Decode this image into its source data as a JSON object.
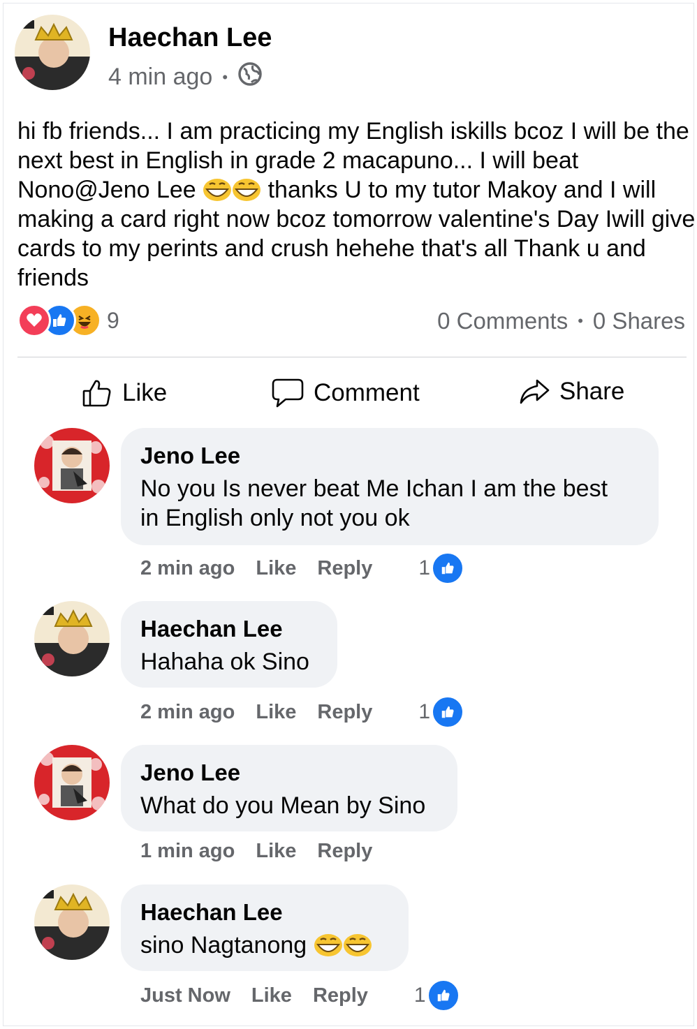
{
  "post": {
    "author": "Haechan Lee",
    "time": "4 min ago",
    "privacy_icon": "globe-icon",
    "text_parts": [
      "hi fb friends... I am practicing my English iskills bcoz I will be the next best in English in grade 2 macapuno... I will beat Nono@Jeno Lee ",
      " thanks U to my tutor Makoy and I will making a card right now bcoz tomorrow valentine's Day Iwill give cards to my perints and crush hehehe that's all Thank u and friends"
    ],
    "reaction_icons": [
      "heart-icon",
      "thumbs-up-icon",
      "laugh-icon"
    ],
    "reaction_count": "9",
    "comments_count": "0 Comments",
    "shares_count": "0 Shares"
  },
  "actions": {
    "like": "Like",
    "comment": "Comment",
    "share": "Share"
  },
  "comments": [
    {
      "name": "Jeno Lee",
      "text_line1": "No you Is never beat Me Ichan I am the best",
      "text_line2": "in English only not you ok",
      "time": "2 min ago",
      "like": "Like",
      "reply": "Reply",
      "likes": "1"
    },
    {
      "name": "Haechan Lee",
      "text_line1": "Hahaha ok Sino",
      "time": "2 min ago",
      "like": "Like",
      "reply": "Reply",
      "likes": "1"
    },
    {
      "name": "Jeno Lee",
      "text_line1": "What do you Mean by Sino",
      "time": "1 min ago",
      "like": "Like",
      "reply": "Reply",
      "likes": ""
    },
    {
      "name": "Haechan Lee",
      "text_line1": "sino Nagtanong",
      "time": "Just Now",
      "like": "Like",
      "reply": "Reply",
      "likes": "1"
    }
  ],
  "colors": {
    "brand_blue": "#1877f2",
    "bubble": "#f0f2f5",
    "secondary_text": "#65676b",
    "love_red": "#f33e58",
    "haha_yellow": "#f7b125"
  }
}
